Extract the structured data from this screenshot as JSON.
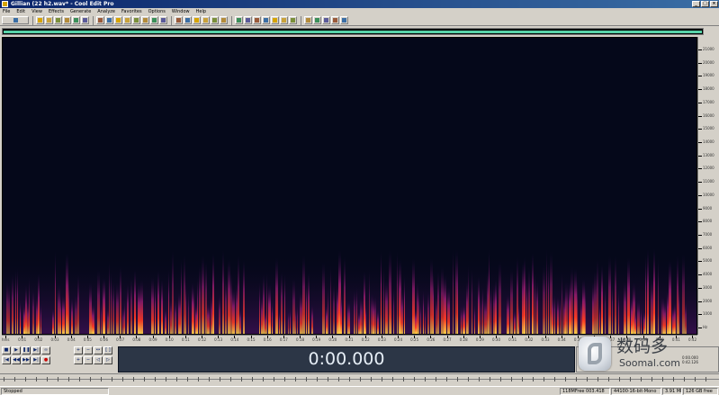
{
  "window": {
    "title": "Gillian (22 h2.wav* - Cool Edit Pro",
    "minimize": "_",
    "maximize": "□",
    "close": "×"
  },
  "menu": [
    "File",
    "Edit",
    "View",
    "Effects",
    "Generate",
    "Analyze",
    "Favorites",
    "Options",
    "Window",
    "Help"
  ],
  "toolbar": {
    "icons": [
      "mode-toggle-icon",
      "new-icon",
      "open-icon",
      "save-icon",
      "close-file-icon",
      "record-icon",
      "undo-icon",
      "cut-icon",
      "copy-icon",
      "paste-icon",
      "paste-new-icon",
      "mix-paste-icon",
      "trim-icon",
      "delete-icon",
      "select-all-icon",
      "zoom-in-icon",
      "zoom-out-icon",
      "zoom-full-icon",
      "zoom-sel-icon",
      "zoom-vert-in-icon",
      "zoom-vert-out-icon",
      "spectral-icon",
      "waveform-icon",
      "snap-icon",
      "cue-icon",
      "marker-icon",
      "loop-icon",
      "sync-icon",
      "effect-amp-icon",
      "effect-eq-icon",
      "effect-delay-icon",
      "effect-noise-icon",
      "effect-reverb-icon"
    ],
    "colors": [
      "#3a6ea5",
      "#d6a400",
      "#c9a23a",
      "#7a8f3a",
      "#b38b3a",
      "#3a8f5a",
      "#5a5a9a",
      "#9a5a3a"
    ]
  },
  "freq_labels": [
    "21000",
    "20000",
    "19000",
    "18000",
    "17000",
    "16000",
    "15000",
    "14000",
    "13000",
    "12000",
    "11000",
    "10000",
    "9000",
    "8000",
    "7000",
    "6000",
    "5000",
    "4000",
    "3000",
    "2000",
    "1000",
    "Hz"
  ],
  "time_labels": [
    "hms",
    "0:01",
    "0:02",
    "0:03",
    "0:04",
    "0:05",
    "0:06",
    "0:07",
    "0:08",
    "0:09",
    "0:10",
    "0:11",
    "0:12",
    "0:13",
    "0:14",
    "0:15",
    "0:16",
    "0:17",
    "0:18",
    "0:19",
    "0:20",
    "0:21",
    "0:22",
    "0:23",
    "0:24",
    "0:25",
    "0:26",
    "0:27",
    "0:28",
    "0:29",
    "0:30",
    "0:31",
    "0:32",
    "0:33",
    "0:34",
    "0:35",
    "0:36",
    "0:37",
    "0:38",
    "0:39",
    "0:40",
    "0:41",
    "0:42"
  ],
  "transport": {
    "stop": "■",
    "play": "▶",
    "pause": "❚❚",
    "play_to_end": "▶|",
    "loop": "∞",
    "go_start": "|◀",
    "rewind": "◀◀",
    "fast_forward": "▶▶",
    "go_end": "▶|",
    "record": "●",
    "zoom_in_h": "+",
    "zoom_out_h": "−",
    "zoom_full": "↔",
    "zoom_sel": "[ ]",
    "zoom_in_v": "+",
    "zoom_out_v": "−",
    "zoom_left": "◁",
    "zoom_right": "▷"
  },
  "time_display": "0:00.000",
  "selection": {
    "begin": "0:00.000",
    "end": "0:42.126"
  },
  "watermark": {
    "logo": "soomal-logo-icon",
    "cn": "数码多",
    "url": "Soomal.com"
  },
  "status": {
    "state": "Stopped",
    "disk": "118MFree  003.418",
    "format": "44100·16-bit·Mono",
    "size": "3.91 MB",
    "free": "126 GB free"
  },
  "colors": {
    "background": "#05081a",
    "spectrum_hot": "#ffd64a",
    "spectrum_mid": "#ff3a22",
    "spectrum_low": "#8a1a6a",
    "overview_bar": "#58d2a8",
    "time_display_bg": "#2c3646"
  }
}
